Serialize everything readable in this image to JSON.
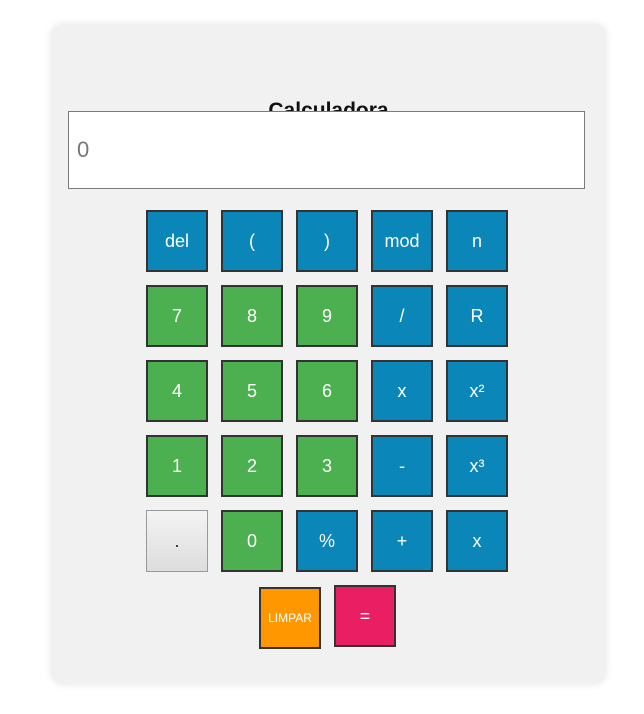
{
  "calculator": {
    "title": "Calculadora",
    "display": {
      "value": "",
      "placeholder": "0"
    },
    "buttons": {
      "del": "del",
      "open_paren": "(",
      "close_paren": ")",
      "mod": "mod",
      "n": "n",
      "seven": "7",
      "eight": "8",
      "nine": "9",
      "divide": "/",
      "r": "R",
      "four": "4",
      "five": "5",
      "six": "6",
      "multiply": "x",
      "square": "x²",
      "one": "1",
      "two": "2",
      "three": "3",
      "minus": "-",
      "cube": "x³",
      "dot": ".",
      "zero": "0",
      "percent": "%",
      "plus": "+",
      "x": "x",
      "limpar": "LIMPAR",
      "equals": "="
    },
    "colors": {
      "operator_blue": "#0a86b8",
      "digit_green": "#4caf50",
      "clear_orange": "#ff9800",
      "equals_pink": "#e91e63"
    }
  }
}
